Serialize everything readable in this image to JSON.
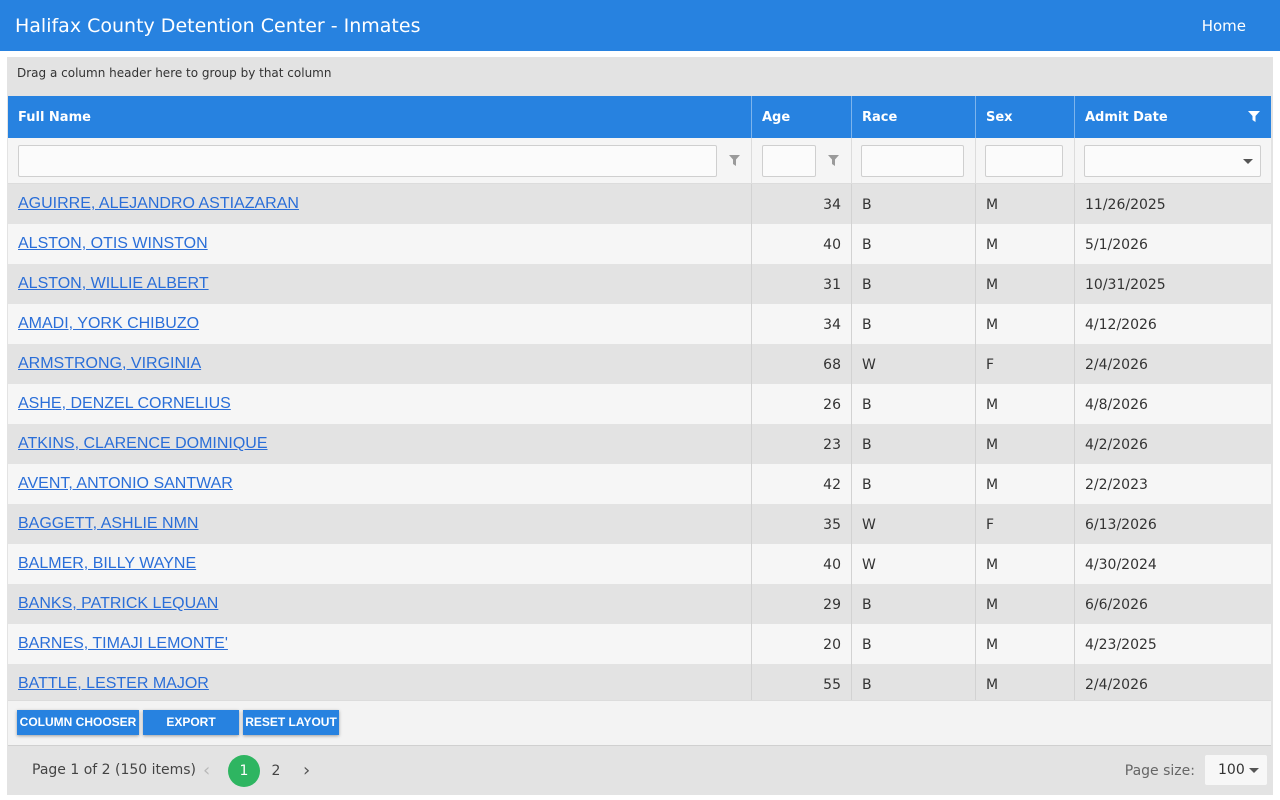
{
  "header": {
    "title": "Halifax County Detention Center - Inmates",
    "home_link": "Home"
  },
  "group_panel": {
    "hint": "Drag a column header here to group by that column"
  },
  "columns": [
    "Full Name",
    "Age",
    "Race",
    "Sex",
    "Admit Date"
  ],
  "rows": [
    {
      "name": "AGUIRRE, ALEJANDRO ASTIAZARAN",
      "age": "34",
      "race": "B",
      "sex": "M",
      "admit": "11/26/2025"
    },
    {
      "name": "ALSTON, OTIS WINSTON",
      "age": "40",
      "race": "B",
      "sex": "M",
      "admit": "5/1/2026"
    },
    {
      "name": "ALSTON, WILLIE ALBERT",
      "age": "31",
      "race": "B",
      "sex": "M",
      "admit": "10/31/2025"
    },
    {
      "name": "AMADI, YORK CHIBUZO",
      "age": "34",
      "race": "B",
      "sex": "M",
      "admit": "4/12/2026"
    },
    {
      "name": "ARMSTRONG, VIRGINIA",
      "age": "68",
      "race": "W",
      "sex": "F",
      "admit": "2/4/2026"
    },
    {
      "name": "ASHE, DENZEL CORNELIUS",
      "age": "26",
      "race": "B",
      "sex": "M",
      "admit": "4/8/2026"
    },
    {
      "name": "ATKINS, CLARENCE DOMINIQUE",
      "age": "23",
      "race": "B",
      "sex": "M",
      "admit": "4/2/2026"
    },
    {
      "name": "AVENT, ANTONIO SANTWAR",
      "age": "42",
      "race": "B",
      "sex": "M",
      "admit": "2/2/2023"
    },
    {
      "name": "BAGGETT, ASHLIE NMN",
      "age": "35",
      "race": "W",
      "sex": "F",
      "admit": "6/13/2026"
    },
    {
      "name": "BALMER, BILLY WAYNE",
      "age": "40",
      "race": "W",
      "sex": "M",
      "admit": "4/30/2024"
    },
    {
      "name": "BANKS, PATRICK LEQUAN",
      "age": "29",
      "race": "B",
      "sex": "M",
      "admit": "6/6/2026"
    },
    {
      "name": "BARNES, TIMAJI LEMONTE'",
      "age": "20",
      "race": "B",
      "sex": "M",
      "admit": "4/23/2025"
    },
    {
      "name": "BATTLE, LESTER MAJOR",
      "age": "55",
      "race": "B",
      "sex": "M",
      "admit": "2/4/2026"
    }
  ],
  "toolbar": {
    "column_chooser": "COLUMN CHOOSER",
    "export": "EXPORT",
    "reset_layout": "RESET LAYOUT"
  },
  "pager": {
    "info": "Page 1 of 2 (150 items)",
    "prev": "‹",
    "next": "›",
    "pages": [
      "1",
      "2"
    ],
    "current_page": "1",
    "page_size_label": "Page size:",
    "page_size": "100"
  },
  "colors": {
    "header_blue": "#2782e0",
    "active_page_green": "#2eb561",
    "link_blue": "#2a6ed8"
  },
  "icons": {
    "filter": "filter-icon",
    "dropdown": "chevron-down-icon"
  }
}
